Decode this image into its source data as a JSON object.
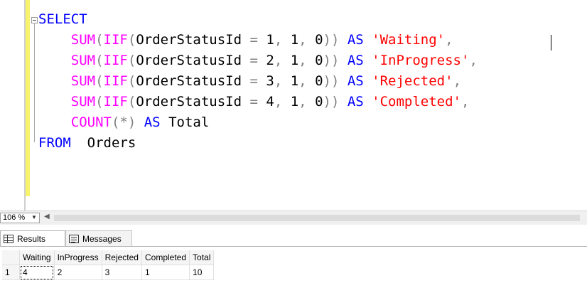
{
  "editor": {
    "lines": [
      [
        {
          "t": "SELECT",
          "c": "kw-blue"
        }
      ],
      [
        {
          "t": "    ",
          "c": "txt"
        },
        {
          "t": "SUM",
          "c": "kw-pink"
        },
        {
          "t": "(",
          "c": "gray"
        },
        {
          "t": "IIF",
          "c": "kw-pink"
        },
        {
          "t": "(",
          "c": "gray"
        },
        {
          "t": "OrderStatusId ",
          "c": "txt"
        },
        {
          "t": "=",
          "c": "gray"
        },
        {
          "t": " 1",
          "c": "txt"
        },
        {
          "t": ",",
          "c": "gray"
        },
        {
          "t": " 1",
          "c": "txt"
        },
        {
          "t": ",",
          "c": "gray"
        },
        {
          "t": " 0",
          "c": "txt"
        },
        {
          "t": "))",
          "c": "gray"
        },
        {
          "t": " AS ",
          "c": "kw-blue"
        },
        {
          "t": "'Waiting'",
          "c": "str"
        },
        {
          "t": ",",
          "c": "gray"
        }
      ],
      [
        {
          "t": "    ",
          "c": "txt"
        },
        {
          "t": "SUM",
          "c": "kw-pink"
        },
        {
          "t": "(",
          "c": "gray"
        },
        {
          "t": "IIF",
          "c": "kw-pink"
        },
        {
          "t": "(",
          "c": "gray"
        },
        {
          "t": "OrderStatusId ",
          "c": "txt"
        },
        {
          "t": "=",
          "c": "gray"
        },
        {
          "t": " 2",
          "c": "txt"
        },
        {
          "t": ",",
          "c": "gray"
        },
        {
          "t": " 1",
          "c": "txt"
        },
        {
          "t": ",",
          "c": "gray"
        },
        {
          "t": " 0",
          "c": "txt"
        },
        {
          "t": "))",
          "c": "gray"
        },
        {
          "t": " AS ",
          "c": "kw-blue"
        },
        {
          "t": "'InProgress'",
          "c": "str"
        },
        {
          "t": ",",
          "c": "gray"
        }
      ],
      [
        {
          "t": "    ",
          "c": "txt"
        },
        {
          "t": "SUM",
          "c": "kw-pink"
        },
        {
          "t": "(",
          "c": "gray"
        },
        {
          "t": "IIF",
          "c": "kw-pink"
        },
        {
          "t": "(",
          "c": "gray"
        },
        {
          "t": "OrderStatusId ",
          "c": "txt"
        },
        {
          "t": "=",
          "c": "gray"
        },
        {
          "t": " 3",
          "c": "txt"
        },
        {
          "t": ",",
          "c": "gray"
        },
        {
          "t": " 1",
          "c": "txt"
        },
        {
          "t": ",",
          "c": "gray"
        },
        {
          "t": " 0",
          "c": "txt"
        },
        {
          "t": "))",
          "c": "gray"
        },
        {
          "t": " AS ",
          "c": "kw-blue"
        },
        {
          "t": "'Rejected'",
          "c": "str"
        },
        {
          "t": ",",
          "c": "gray"
        }
      ],
      [
        {
          "t": "    ",
          "c": "txt"
        },
        {
          "t": "SUM",
          "c": "kw-pink"
        },
        {
          "t": "(",
          "c": "gray"
        },
        {
          "t": "IIF",
          "c": "kw-pink"
        },
        {
          "t": "(",
          "c": "gray"
        },
        {
          "t": "OrderStatusId ",
          "c": "txt"
        },
        {
          "t": "=",
          "c": "gray"
        },
        {
          "t": " 4",
          "c": "txt"
        },
        {
          "t": ",",
          "c": "gray"
        },
        {
          "t": " 1",
          "c": "txt"
        },
        {
          "t": ",",
          "c": "gray"
        },
        {
          "t": " 0",
          "c": "txt"
        },
        {
          "t": "))",
          "c": "gray"
        },
        {
          "t": " AS ",
          "c": "kw-blue"
        },
        {
          "t": "'Completed'",
          "c": "str"
        },
        {
          "t": ",",
          "c": "gray"
        }
      ],
      [
        {
          "t": "    ",
          "c": "txt"
        },
        {
          "t": "COUNT",
          "c": "kw-pink"
        },
        {
          "t": "(*)",
          "c": "gray"
        },
        {
          "t": " AS ",
          "c": "kw-blue"
        },
        {
          "t": "Total",
          "c": "txt"
        }
      ],
      [
        {
          "t": "FROM ",
          "c": "kw-blue"
        },
        {
          "t": " Orders",
          "c": "txt"
        }
      ]
    ]
  },
  "zoom": {
    "value": "106 %"
  },
  "results": {
    "tabs": {
      "results": "Results",
      "messages": "Messages"
    },
    "columns": [
      "Waiting",
      "InProgress",
      "Rejected",
      "Completed",
      "Total"
    ],
    "row_number": "1",
    "row": [
      "4",
      "2",
      "3",
      "1",
      "10"
    ]
  },
  "colors": {
    "keyword": "#0000ff",
    "function": "#ff00ff",
    "string": "#ff0000",
    "operator": "#808080",
    "changebar": "#f7f36b"
  }
}
